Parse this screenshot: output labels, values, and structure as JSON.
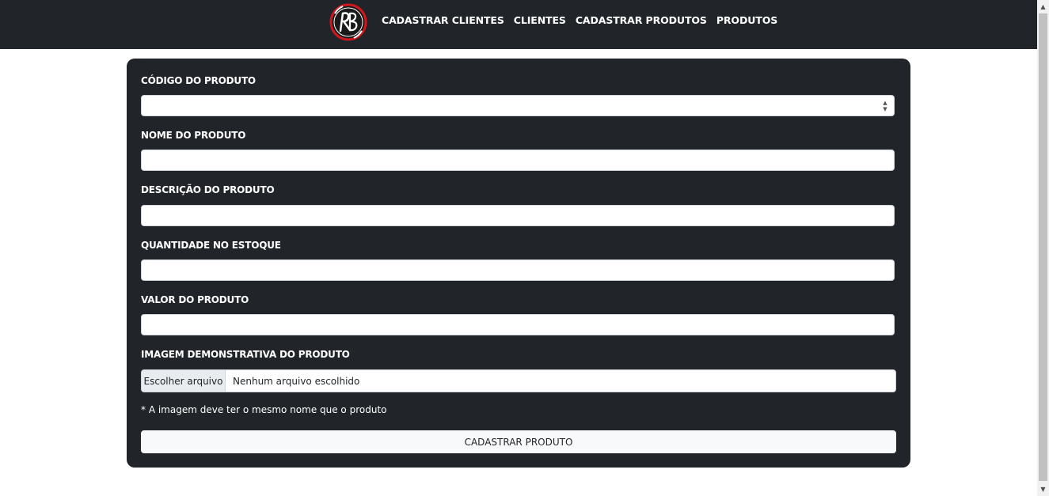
{
  "navbar": {
    "logo_icon": "rb-logo-icon",
    "links": [
      {
        "label": "CADASTRAR CLIENTES"
      },
      {
        "label": "CLIENTES"
      },
      {
        "label": "CADASTRAR PRODUTOS"
      },
      {
        "label": "PRODUTOS"
      }
    ],
    "background": "#212529",
    "logo_accent": "#d0171d"
  },
  "form": {
    "background": "#212529",
    "fields": {
      "codigo": {
        "label": "CÓDIGO DO PRODUTO",
        "value": ""
      },
      "nome": {
        "label": "NOME DO PRODUTO",
        "value": ""
      },
      "descricao": {
        "label": "DESCRIÇÃO DO PRODUTO",
        "value": ""
      },
      "quantidade": {
        "label": "QUANTIDADE NO ESTOQUE",
        "value": ""
      },
      "valor": {
        "label": "VALOR DO PRODUTO",
        "value": ""
      }
    },
    "imagem": {
      "label": "IMAGEM DEMONSTRATIVA DO PRODUTO",
      "button_label": "Escolher arquivo",
      "status": "Nenhum arquivo escolhido",
      "note": "* A imagem deve ter o mesmo nome que o produto"
    },
    "submit_label": "CADASTRAR PRODUTO"
  }
}
